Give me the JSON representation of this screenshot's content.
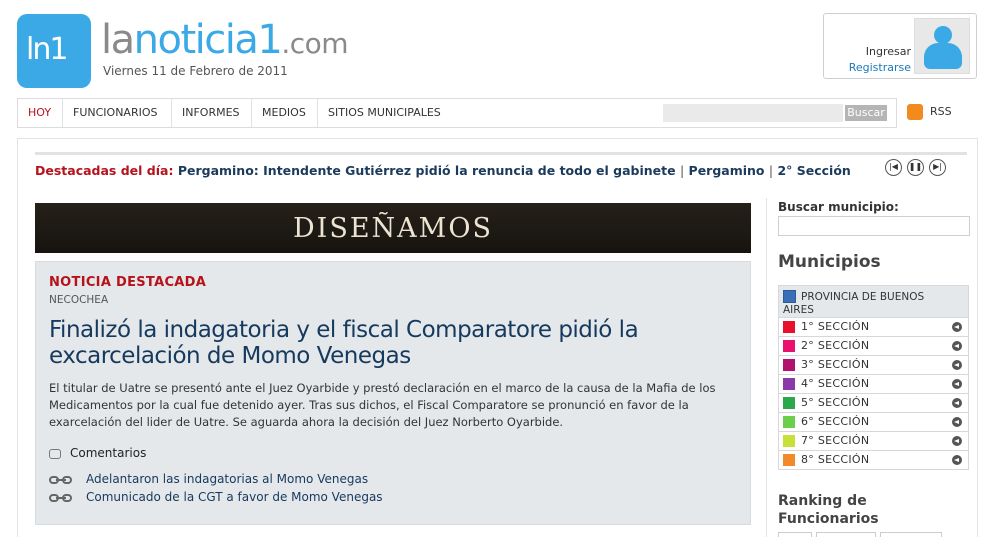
{
  "brand": {
    "logo_mark": "ln1",
    "name_part1": "la",
    "name_part2": "noticia1",
    "name_part3": ".com",
    "date": "Viernes 11 de Febrero de 2011"
  },
  "login": {
    "ingresar": "Ingresar",
    "registrarse": "Registrarse",
    "avatar_icon": "user-avatar-icon"
  },
  "nav": {
    "items": [
      "HOY",
      "FUNCIONARIOS",
      "INFORMES",
      "MEDIOS",
      "SITIOS MUNICIPALES"
    ],
    "search_button": "Buscar",
    "rss_label": "RSS"
  },
  "ticker": {
    "label": "Destacadas del día:",
    "headline": "Pergamino: Intendente Gutiérrez pidió la renuncia de todo el gabinete",
    "separator": "|",
    "tag1": "Pergamino",
    "tag2": "2° Sección",
    "controls": [
      "previous-icon",
      "pause-icon",
      "next-icon"
    ]
  },
  "banner": {
    "text": "DISEÑAMOS"
  },
  "featured": {
    "label": "NOTICIA DESTACADA",
    "place": "NECOCHEA",
    "title": "Finalizó la indagatoria y el fiscal Comparatore pidió la excarcelación de Momo Venegas",
    "body": "El titular de Uatre se presentó ante el Juez Oyarbide y prestó declaración en el marco de la causa de la Mafia de los Medicamentos por la cual fue detenido ayer. Tras sus dichos, el Fiscal Comparatore se pronunció en favor de la exarcelación del lider de Uatre. Se aguarda ahora la decisión del Juez Norberto Oyarbide.",
    "comments": "Comentarios",
    "related": [
      "Adelantaron las indagatorias al Momo Venegas",
      "Comunicado de la CGT a favor de Momo Venegas"
    ]
  },
  "sidebar": {
    "search_label": "Buscar municipio:",
    "municipios_title": "Municipios",
    "province_line1": "PROVINCIA DE BUENOS",
    "province_line2": "AIRES",
    "province_color": "#3a6fb8",
    "sections": [
      {
        "label": "1° SECCIÓN",
        "color": "#e8102a"
      },
      {
        "label": "2° SECCIÓN",
        "color": "#e8126e"
      },
      {
        "label": "3° SECCIÓN",
        "color": "#b0126e"
      },
      {
        "label": "4° SECCIÓN",
        "color": "#8a3aa8"
      },
      {
        "label": "5° SECCIÓN",
        "color": "#2aa84a"
      },
      {
        "label": "6° SECCIÓN",
        "color": "#6ccf4a"
      },
      {
        "label": "7° SECCIÓN",
        "color": "#c8e03a"
      },
      {
        "label": "8° SECCIÓN",
        "color": "#f28a2a"
      }
    ],
    "ranking_title": "Ranking de Funcionarios"
  },
  "colors": {
    "brand_blue": "#3aa9e6",
    "accent_red": "#b5121b",
    "headline_navy": "#16395e"
  }
}
